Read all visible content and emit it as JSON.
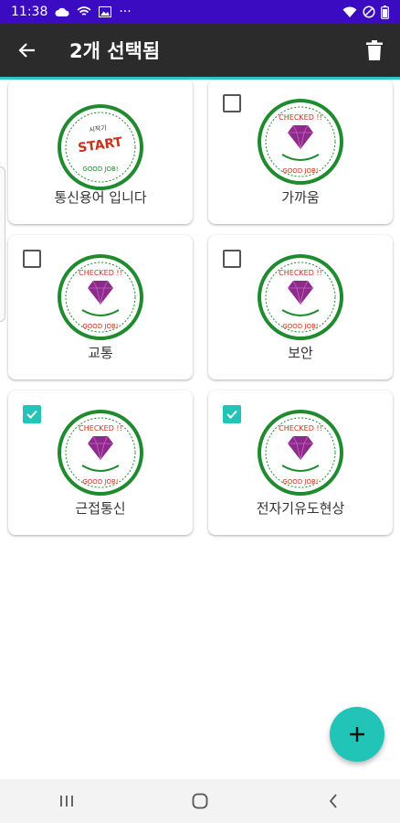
{
  "status": {
    "time": "11:38",
    "dots": "···"
  },
  "appbar": {
    "title": "2개 선택됨"
  },
  "badges": {
    "start_top": "시작기",
    "start_main": "START",
    "good_job": "GOOD JOB!",
    "checked": "CHECKED !!"
  },
  "cards": [
    {
      "label": "통신용어 입니다",
      "badge": "start",
      "checkbox": "none"
    },
    {
      "label": "가까움",
      "badge": "checked",
      "checkbox": "unchecked"
    },
    {
      "label": "교통",
      "badge": "checked",
      "checkbox": "unchecked"
    },
    {
      "label": "보안",
      "badge": "checked",
      "checkbox": "unchecked"
    },
    {
      "label": "근접통신",
      "badge": "checked",
      "checkbox": "checked"
    },
    {
      "label": "전자기유도현상",
      "badge": "checked",
      "checkbox": "checked"
    }
  ],
  "colors": {
    "status_bar": "#3b0bc2",
    "appbar": "#2b2b2b",
    "accent": "#22c4b7",
    "badge_ring": "#1f8a2e",
    "gem": "#8e2a8c",
    "stamp_red": "#c8321e"
  },
  "icons": {
    "back": "arrow-left-icon",
    "delete": "trash-icon",
    "fab": "plus-icon",
    "nav_recents": "recent-apps-icon",
    "nav_home": "home-icon",
    "nav_back": "nav-back-icon"
  }
}
